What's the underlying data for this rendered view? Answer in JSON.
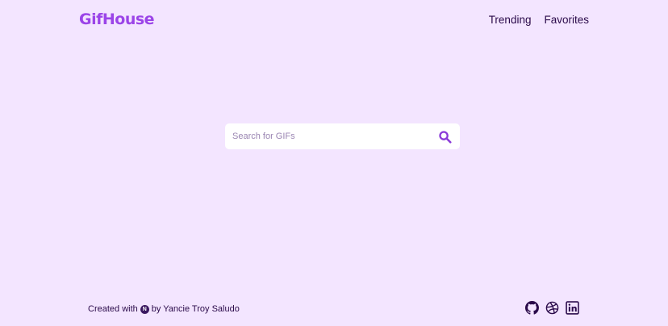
{
  "header": {
    "logo": "GifHouse",
    "nav": [
      {
        "label": "Trending"
      },
      {
        "label": "Favorites"
      }
    ]
  },
  "search": {
    "placeholder": "Search for GIFs",
    "value": "",
    "icon": "search-icon"
  },
  "footer": {
    "created_with": "Created with",
    "framework_badge": "N",
    "by_text": "by Yancie Troy Saludo",
    "socials": [
      {
        "icon": "github-icon"
      },
      {
        "icon": "dribbble-icon"
      },
      {
        "icon": "linkedin-icon"
      }
    ]
  },
  "colors": {
    "background": "#f3e5ff",
    "brand": "#9b44e8",
    "text": "#2a0a4a",
    "accent": "#8a3ad8"
  }
}
